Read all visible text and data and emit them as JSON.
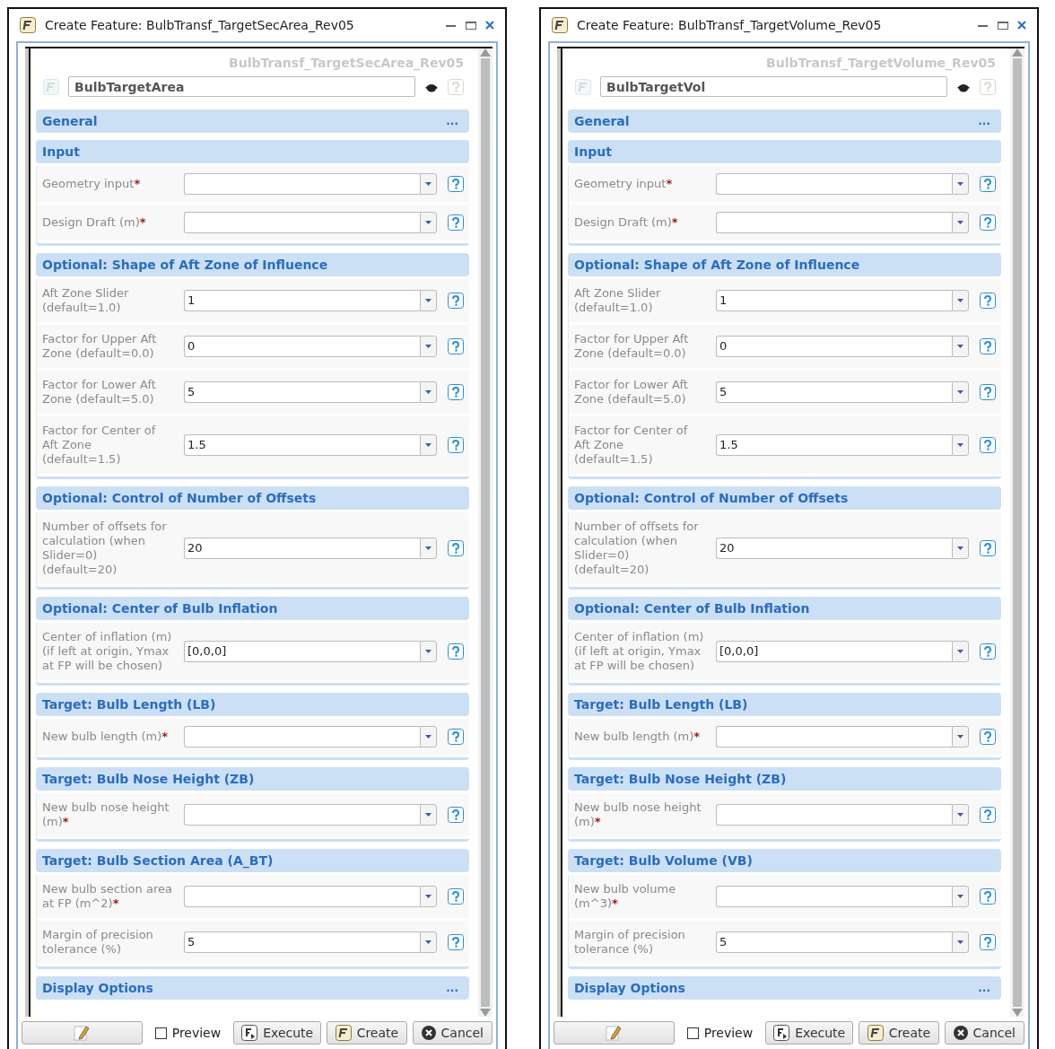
{
  "windows": [
    {
      "title": "Create Feature: BulbTransf_TargetSecArea_Rev05",
      "definition": "BulbTransf_TargetSecArea_Rev05",
      "name_value": "BulbTargetArea",
      "sections": [
        {
          "title": "General",
          "menu": "..."
        },
        {
          "title": "Input",
          "rows": [
            {
              "label": "Geometry input",
              "required_mark": "*"
            },
            {
              "label": "Design Draft (m)",
              "required_mark": "*"
            }
          ]
        },
        {
          "title": "Optional: Shape of Aft Zone of Influence",
          "rows": [
            {
              "label": "Aft Zone Slider (default=1.0)",
              "value": "1"
            },
            {
              "label": "Factor for Upper Aft Zone (default=0.0)",
              "value": "0"
            },
            {
              "label": "Factor for Lower Aft Zone (default=5.0)",
              "value": "5"
            },
            {
              "label": "Factor for Center of Aft Zone (default=1.5)",
              "value": "1.5"
            }
          ]
        },
        {
          "title": "Optional: Control of Number of Offsets",
          "rows": [
            {
              "label": "Number of offsets for calculation (when Slider=0) (default=20)",
              "value": "20"
            }
          ]
        },
        {
          "title": "Optional: Center of Bulb Inflation",
          "rows": [
            {
              "label": "Center of inflation (m) (if left at origin, Ymax at FP will be chosen)",
              "value": "[0,0,0]"
            }
          ]
        },
        {
          "title": "Target: Bulb Length (LB)",
          "rows": [
            {
              "label": "New bulb length (m)",
              "required_mark": "*"
            }
          ]
        },
        {
          "title": "Target: Bulb Nose Height (ZB)",
          "rows": [
            {
              "label": "New bulb nose height (m)",
              "required_mark": "*"
            }
          ]
        },
        {
          "title": "Target: Bulb Section Area (A_BT)",
          "rows": [
            {
              "label": "New bulb section area at FP (m^2)",
              "required_mark": "*"
            },
            {
              "label": "Margin of precision tolerance (%)",
              "value": "5"
            }
          ]
        },
        {
          "title": "Display Options",
          "menu": "..."
        }
      ],
      "preview": {
        "label": "Preview",
        "checked": false
      },
      "buttons": [
        {
          "kind": "edit"
        },
        {
          "kind": "execute",
          "label": "Execute"
        },
        {
          "kind": "create",
          "label": "Create"
        },
        {
          "kind": "cancel",
          "label": "Cancel"
        }
      ]
    },
    {
      "title": "Create Feature: BulbTransf_TargetVolume_Rev05",
      "definition": "BulbTransf_TargetVolume_Rev05",
      "name_value": "BulbTargetVol",
      "sections": [
        {
          "title": "General",
          "menu": "..."
        },
        {
          "title": "Input",
          "rows": [
            {
              "label": "Geometry input",
              "required_mark": "*"
            },
            {
              "label": "Design Draft (m)",
              "required_mark": "*"
            }
          ]
        },
        {
          "title": "Optional: Shape of Aft Zone of Influence",
          "rows": [
            {
              "label": "Aft Zone Slider (default=1.0)",
              "value": "1"
            },
            {
              "label": "Factor for Upper Aft Zone (default=0.0)",
              "value": "0"
            },
            {
              "label": "Factor for Lower Aft Zone (default=5.0)",
              "value": "5"
            },
            {
              "label": "Factor for Center of Aft Zone (default=1.5)",
              "value": "1.5"
            }
          ]
        },
        {
          "title": "Optional: Control of Number of Offsets",
          "rows": [
            {
              "label": "Number of offsets for calculation (when Slider=0) (default=20)",
              "value": "20"
            }
          ]
        },
        {
          "title": "Optional: Center of Bulb Inflation",
          "rows": [
            {
              "label": "Center of inflation (m) (if left at origin, Ymax at FP will be chosen)",
              "value": "[0,0,0]"
            }
          ]
        },
        {
          "title": "Target: Bulb Length (LB)",
          "rows": [
            {
              "label": "New bulb length (m)",
              "required_mark": "*"
            }
          ]
        },
        {
          "title": "Target: Bulb Nose Height (ZB)",
          "rows": [
            {
              "label": "New bulb nose height (m)",
              "required_mark": "*"
            }
          ]
        },
        {
          "title": "Target: Bulb Volume (VB)",
          "rows": [
            {
              "label": "New bulb volume (m^3)",
              "required_mark": "*"
            },
            {
              "label": "Margin of precision tolerance (%)",
              "value": "5"
            }
          ]
        },
        {
          "title": "Display Options",
          "menu": "..."
        }
      ],
      "preview": {
        "label": "Preview",
        "checked": false
      },
      "buttons": [
        {
          "kind": "edit"
        },
        {
          "kind": "execute",
          "label": "Execute"
        },
        {
          "kind": "create",
          "label": "Create"
        },
        {
          "kind": "cancel",
          "label": "Cancel"
        }
      ]
    }
  ]
}
